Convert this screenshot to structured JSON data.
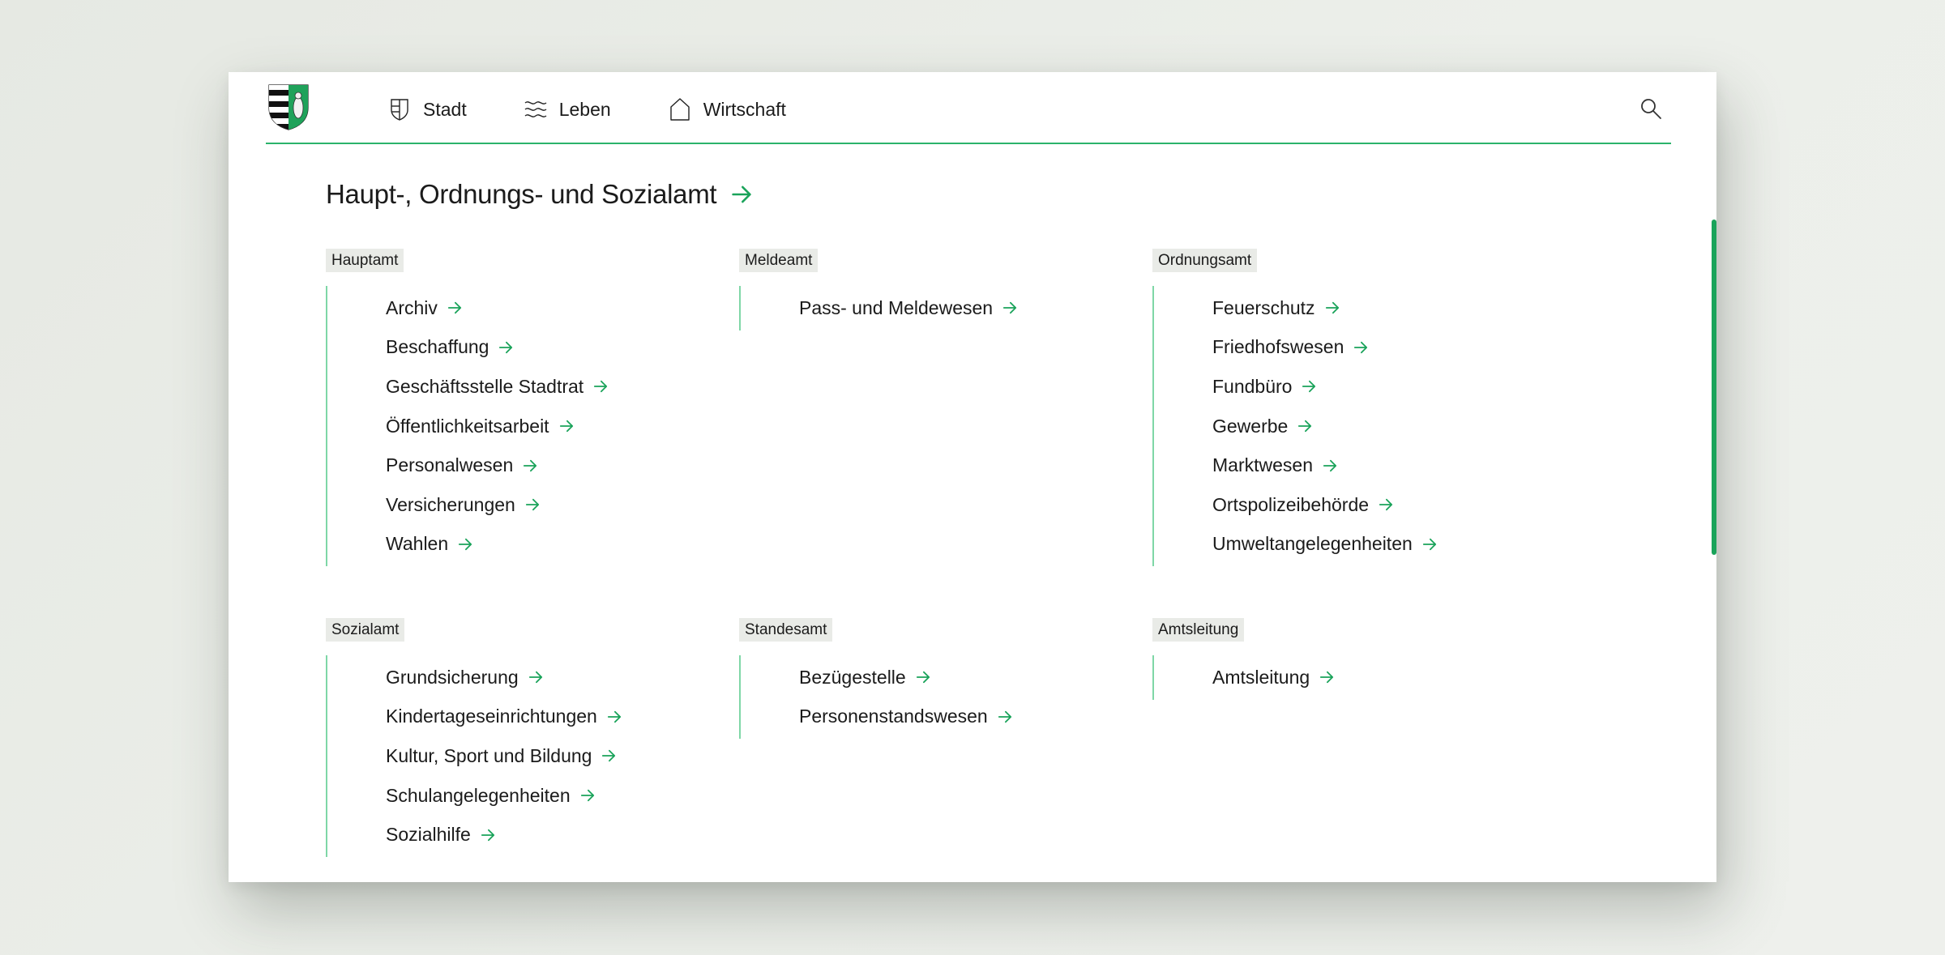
{
  "nav": {
    "items": [
      {
        "label": "Stadt",
        "icon": "shield-outline-icon"
      },
      {
        "label": "Leben",
        "icon": "waves-icon"
      },
      {
        "label": "Wirtschaft",
        "icon": "house-outline-icon"
      }
    ],
    "search_icon": "search-icon",
    "logo": "coat-of-arms-logo"
  },
  "page": {
    "title": "Haupt-, Ordnungs- und Sozialamt"
  },
  "groups": [
    {
      "label": "Hauptamt",
      "items": [
        "Archiv",
        "Beschaffung",
        "Geschäftsstelle Stadtrat",
        "Öffentlichkeitsarbeit",
        "Personalwesen",
        "Versicherungen",
        "Wahlen"
      ]
    },
    {
      "label": "Meldeamt",
      "items": [
        "Pass- und Meldewesen"
      ]
    },
    {
      "label": "Ordnungsamt",
      "items": [
        "Feuerschutz",
        "Friedhofswesen",
        "Fundbüro",
        "Gewerbe",
        "Marktwesen",
        "Ortspolizeibehörde",
        "Umweltangelegenheiten"
      ]
    },
    {
      "label": "Sozialamt",
      "items": [
        "Grundsicherung",
        "Kindertageseinrichtungen",
        "Kultur, Sport und Bildung",
        "Schulangelegenheiten",
        "Sozialhilfe"
      ]
    },
    {
      "label": "Standesamt",
      "items": [
        "Bezügestelle",
        "Personenstandswesen"
      ]
    },
    {
      "label": "Amtsleitung",
      "items": [
        "Amtsleitung"
      ]
    }
  ],
  "colors": {
    "accent": "#2bb36b",
    "accent_dark": "#1aa35a",
    "tag_bg": "#e9ebe7",
    "text": "#1b1b1b"
  }
}
